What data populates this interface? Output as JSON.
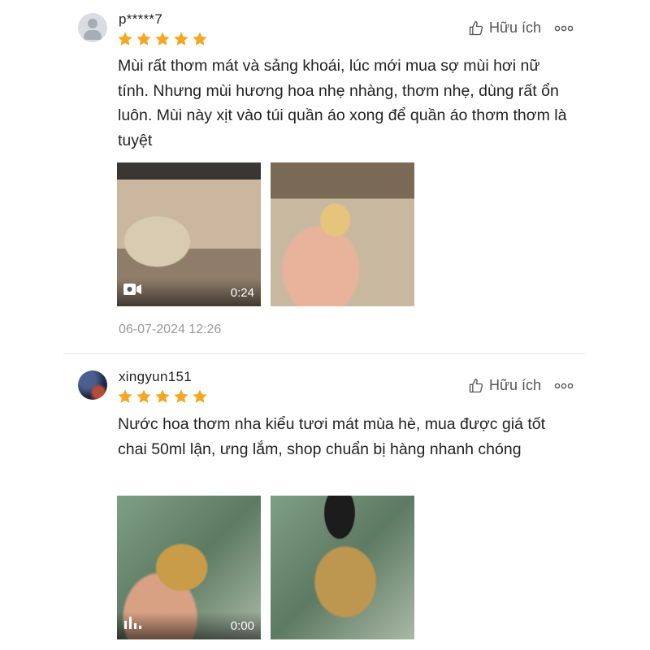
{
  "reviews": [
    {
      "username": "p*****7",
      "rating": 5,
      "helpful_label": "Hữu ích",
      "content": "Mùi rất thơm mát và sảng khoái, lúc mới mua sợ mùi hơi nữ tính. Nhưng mùi hương hoa nhẹ nhàng, thơm nhẹ, dùng rất ổn luôn. Mùi này xịt vào túi quần áo xong để quần áo thơm thơm là tuyệt",
      "video_duration": "0:24",
      "date": "06-07-2024 12:26"
    },
    {
      "username": "xingyun151",
      "rating": 5,
      "helpful_label": "Hữu ích",
      "content": "Nước hoa thơm nha kiểu tươi mát mùa hè, mua được giá tốt chai 50ml lận, ưng lắm, shop chuẩn bị hàng nhanh chóng",
      "video_duration": "0:00"
    }
  ],
  "colors": {
    "star": "#f5a623",
    "text": "#222222",
    "muted": "#999999"
  }
}
